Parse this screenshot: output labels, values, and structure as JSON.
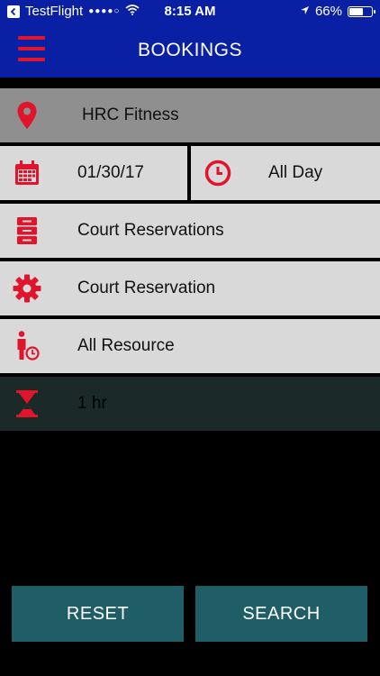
{
  "status_bar": {
    "carrier": "TestFlight",
    "signal": "●●●●○",
    "time": "8:15 AM",
    "battery_percent": "66%",
    "battery_level": 0.66
  },
  "header": {
    "title": "BOOKINGS"
  },
  "form": {
    "location": "HRC Fitness",
    "date": "01/30/17",
    "time": "All Day",
    "category": "Court Reservations",
    "type": "Court Reservation",
    "resource": "All Resource",
    "duration": "1 hr"
  },
  "buttons": {
    "reset_label": "RESET",
    "search_label": "SEARCH"
  },
  "colors": {
    "header_bg": "#0a20a4",
    "accent_red": "#e0142a",
    "button_bg": "#1f5e66",
    "row_bg": "#d9d9d9"
  },
  "icons": {
    "location": "location-pin-icon",
    "date": "calendar-icon",
    "time": "clock-icon",
    "category": "cabinet-icon",
    "type": "gear-icon",
    "resource": "person-clock-icon",
    "duration": "hourglass-icon"
  }
}
